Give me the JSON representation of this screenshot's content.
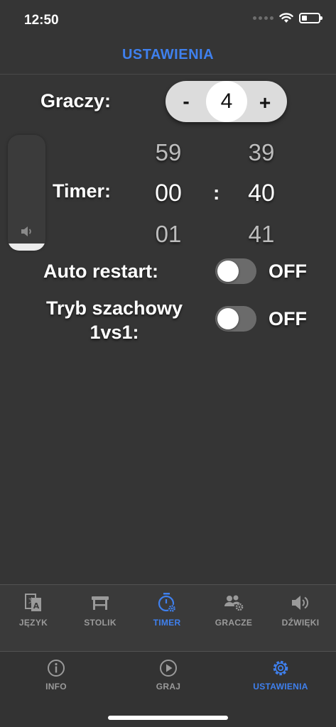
{
  "status_bar": {
    "time": "12:50"
  },
  "header": {
    "title": "USTAWIENIA"
  },
  "players": {
    "label": "Graczy:",
    "minus": "-",
    "plus": "+",
    "value": "4"
  },
  "volume": {
    "level": 0.06
  },
  "timer": {
    "label": "Timer:",
    "separator": ":",
    "minutes": {
      "prev": "59",
      "current": "00",
      "next": "01"
    },
    "seconds": {
      "prev": "39",
      "current": "40",
      "next": "41"
    }
  },
  "auto_restart": {
    "label": "Auto restart:",
    "status": "OFF"
  },
  "chess_mode": {
    "label_line1": "Tryb szachowy",
    "label_line2": "1vs1:",
    "status": "OFF"
  },
  "sub_tabs": [
    {
      "label": "JĘZYK",
      "icon": "language-icon"
    },
    {
      "label": "STOLIK",
      "icon": "table-icon"
    },
    {
      "label": "TIMER",
      "icon": "timer-gear-icon",
      "active": true
    },
    {
      "label": "GRACZE",
      "icon": "players-gear-icon"
    },
    {
      "label": "DŹWIĘKI",
      "icon": "speaker-icon"
    }
  ],
  "tabs": [
    {
      "label": "INFO",
      "icon": "info-icon"
    },
    {
      "label": "GRAJ",
      "icon": "play-icon"
    },
    {
      "label": "USTAWIENIA",
      "icon": "settings-gear-icon",
      "active": true
    }
  ],
  "colors": {
    "accent": "#3f80ee",
    "background": "#353535",
    "inactive": "#9a9a9a"
  }
}
